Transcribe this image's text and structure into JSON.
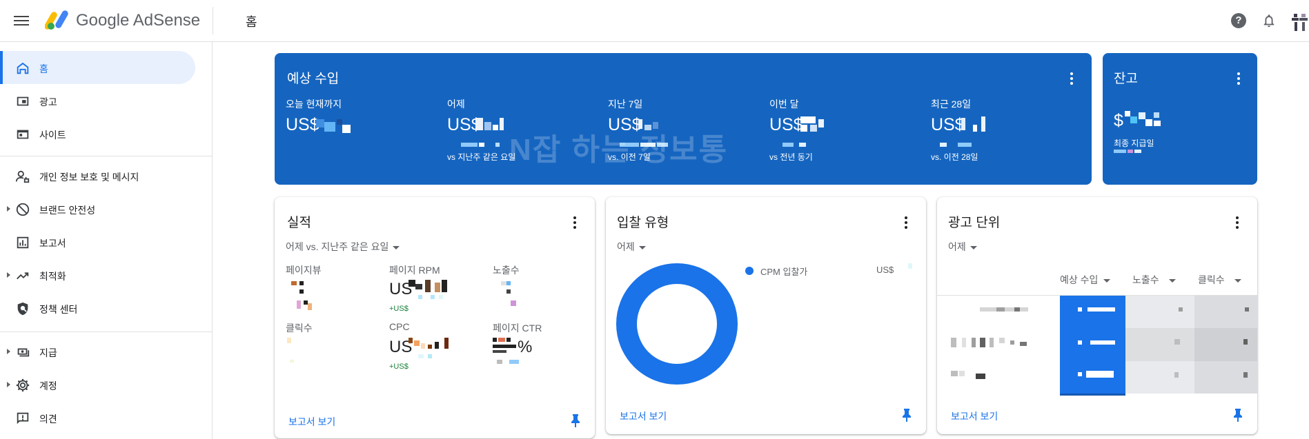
{
  "app": {
    "brand": "Google AdSense",
    "breadcrumb": "홈"
  },
  "sidebar": {
    "items": [
      {
        "label": "홈",
        "icon": "home-icon"
      },
      {
        "label": "광고",
        "icon": "ads-icon"
      },
      {
        "label": "사이트",
        "icon": "sites-icon"
      },
      {
        "label": "개인 정보 보호 및 메시지",
        "icon": "privacy-icon"
      },
      {
        "label": "브랜드 안전성",
        "icon": "block-icon"
      },
      {
        "label": "보고서",
        "icon": "reports-icon"
      },
      {
        "label": "최적화",
        "icon": "trending-icon"
      },
      {
        "label": "정책 센터",
        "icon": "shield-icon"
      },
      {
        "label": "지급",
        "icon": "payments-icon"
      },
      {
        "label": "계정",
        "icon": "gear-icon"
      },
      {
        "label": "의견",
        "icon": "feedback-icon"
      }
    ]
  },
  "earnings": {
    "title": "예상 수입",
    "metrics": [
      {
        "label": "오늘 현재까지",
        "value": "US$",
        "compare": ""
      },
      {
        "label": "어제",
        "value": "US$",
        "compare": "vs 지난주 같은 요일"
      },
      {
        "label": "지난 7일",
        "value": "US$",
        "compare": "vs. 이전 7일"
      },
      {
        "label": "이번 달",
        "value": "US$",
        "compare": "vs 전년 동기"
      },
      {
        "label": "최근 28일",
        "value": "US$",
        "compare": "vs. 이전 28일"
      }
    ],
    "watermark": "N잡 하는 정보통"
  },
  "balance": {
    "title": "잔고",
    "value": "$",
    "sub": "최종 지급일"
  },
  "performance": {
    "title": "실적",
    "filter": "어제 vs. 지난주 같은 요일",
    "metrics": [
      {
        "label": "페이지뷰",
        "value": "",
        "delta": ""
      },
      {
        "label": "페이지 RPM",
        "value": "US",
        "delta": "+US$"
      },
      {
        "label": "노출수",
        "value": "",
        "delta": ""
      },
      {
        "label": "클릭수",
        "value": "",
        "delta": ""
      },
      {
        "label": "CPC",
        "value": "US",
        "delta": "+US$"
      },
      {
        "label": "페이지 CTR",
        "value": "%",
        "delta": ""
      }
    ],
    "link": "보고서 보기"
  },
  "bid_types": {
    "title": "입찰 유형",
    "filter": "어제",
    "legend": [
      {
        "name": "CPM 입찰가",
        "value": "US$",
        "color": "#1a73e8"
      }
    ],
    "chart_data": {
      "type": "pie",
      "categories": [
        "CPM 입찰가"
      ],
      "values": [
        100
      ]
    },
    "link": "보고서 보기"
  },
  "ad_units": {
    "title": "광고 단위",
    "filter": "어제",
    "columns": [
      "예상 수입",
      "노출수",
      "클릭수"
    ],
    "link": "보고서 보기"
  },
  "colors": {
    "accent": "#1a73e8",
    "earnings_card": "#1565c0",
    "active_nav": "#e8f0fe"
  }
}
